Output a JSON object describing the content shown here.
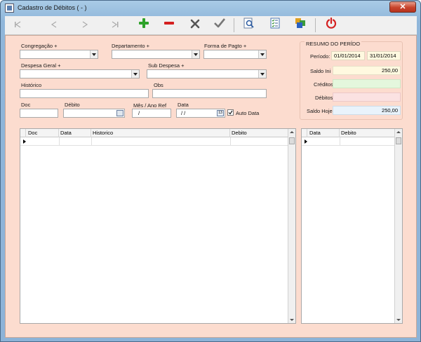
{
  "window": {
    "title": "Cadastro de Débitos ( - )",
    "close_label": "✕"
  },
  "toolbar": {
    "buttons": [
      {
        "name": "first-record-button",
        "icon": "first-icon"
      },
      {
        "name": "prev-record-button",
        "icon": "prev-icon"
      },
      {
        "name": "next-record-button",
        "icon": "next-icon"
      },
      {
        "name": "last-record-button",
        "icon": "last-icon"
      },
      {
        "name": "add-button",
        "icon": "plus-icon"
      },
      {
        "name": "delete-button",
        "icon": "minus-icon"
      },
      {
        "name": "cancel-button",
        "icon": "x-icon"
      },
      {
        "name": "confirm-button",
        "icon": "check-icon"
      },
      {
        "name": "search-button",
        "icon": "search-icon"
      },
      {
        "name": "report-button",
        "icon": "checklist-icon"
      },
      {
        "name": "chart-button",
        "icon": "chart-icon"
      },
      {
        "name": "exit-button",
        "icon": "power-icon"
      }
    ]
  },
  "form": {
    "congregacao_label": "Congregação +",
    "departamento_label": "Departamento +",
    "forma_pagto_label": "Forma de Pagto +",
    "despesa_geral_label": "Despesa Geral +",
    "sub_despesa_label": "Sub Despesa +",
    "historico_label": "Histórico",
    "obs_label": "Obs",
    "doc_label": "Doc",
    "debito_label": "Débito",
    "mes_ano_label": "Mês / Ano Ref",
    "mes_ano_value": "/",
    "data_label": "Data",
    "data_value": "/ /",
    "auto_data_label": "Auto Data",
    "auto_data_checked": true
  },
  "resumo": {
    "title": "RESUMO DO PERÍDO",
    "periodo_label": "Período:",
    "periodo_start": "01/01/2014",
    "periodo_end": "31/01/2014",
    "saldo_ini_label": "Saldo Ini",
    "saldo_ini_value": "250,00",
    "creditos_label": "Créditos",
    "creditos_value": "",
    "debitos_label": "Débitos",
    "debitos_value": "",
    "saldo_hoje_label": "Saldo Hoje",
    "saldo_hoje_value": "250,00"
  },
  "colors": {
    "client_bg": "#fcdccf",
    "saldo_ini_bg": "#fff9e0",
    "creditos_bg": "#e4f7dd",
    "debitos_bg": "#fbe2e2",
    "saldo_hoje_bg": "#e9f3fb"
  },
  "main_grid": {
    "columns": [
      "Doc",
      "Data",
      "Historico",
      "Debito"
    ]
  },
  "side_grid": {
    "columns": [
      "Data",
      "Debito"
    ]
  }
}
